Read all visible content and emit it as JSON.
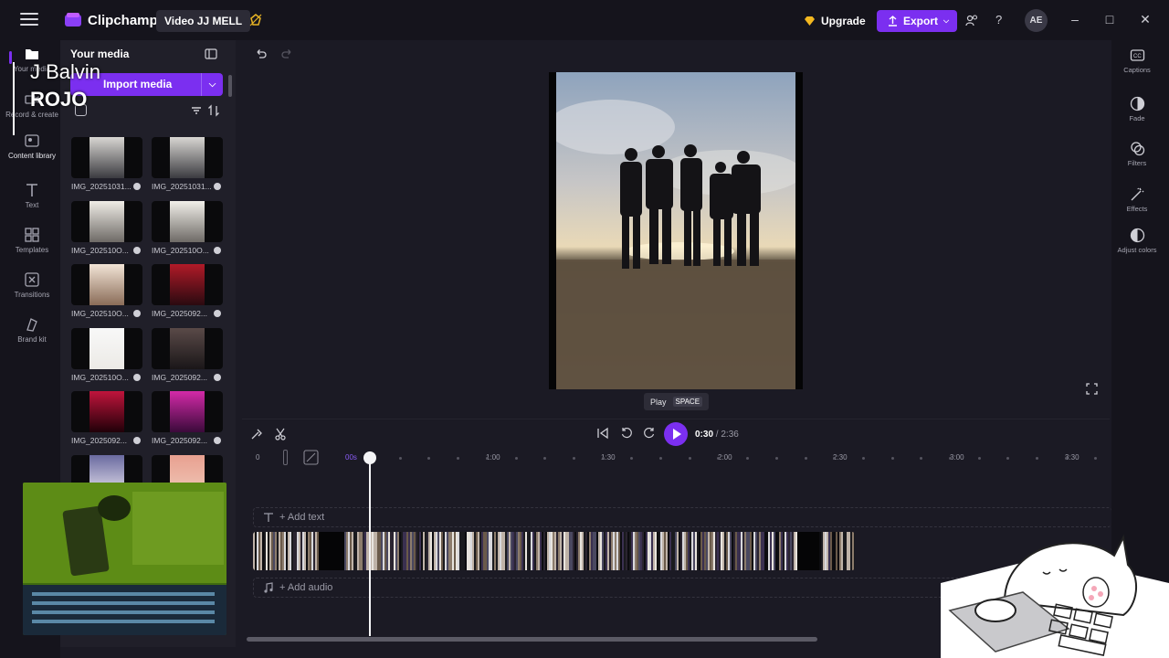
{
  "header": {
    "app_name": "Clipchamp",
    "project_name": "Video JJ MELL",
    "upgrade_label": "Upgrade",
    "export_label": "Export",
    "avatar_initials": "AE",
    "accent_color": "#7b2ff0"
  },
  "left_nav": {
    "items": [
      {
        "label": "Your media",
        "icon": "folder-icon"
      },
      {
        "label": "Record & create",
        "icon": "record-icon"
      },
      {
        "label": "Content library",
        "icon": "library-icon"
      },
      {
        "label": "Text",
        "icon": "text-icon"
      },
      {
        "label": "Templates",
        "icon": "templates-icon"
      },
      {
        "label": "Transitions",
        "icon": "transitions-icon"
      },
      {
        "label": "Brand kit",
        "icon": "brand-kit-icon"
      }
    ]
  },
  "media_panel": {
    "title": "Your media",
    "import_label": "Import media",
    "items": [
      {
        "name": "IMG_20251031..."
      },
      {
        "name": "IMG_20251031..."
      },
      {
        "name": "IMG_202510O..."
      },
      {
        "name": "IMG_202510O..."
      },
      {
        "name": "IMG_202510O..."
      },
      {
        "name": "IMG_2025092..."
      },
      {
        "name": "IMG_202510O..."
      },
      {
        "name": "IMG_2025092..."
      },
      {
        "name": "IMG_2025092..."
      },
      {
        "name": "IMG_2025092..."
      },
      {
        "name": ""
      },
      {
        "name": ""
      }
    ]
  },
  "player": {
    "tooltip_label": "Play",
    "tooltip_key": "SPACE",
    "current_time": "0:30",
    "total_time": "/ 2:36"
  },
  "right_panel": {
    "items": [
      {
        "label": "Captions",
        "icon": "captions-icon"
      },
      {
        "label": "Fade",
        "icon": "fade-icon"
      },
      {
        "label": "Filters",
        "icon": "filters-icon"
      },
      {
        "label": "Effects",
        "icon": "effects-icon"
      },
      {
        "label": "Adjust colors",
        "icon": "adjust-colors-icon"
      }
    ]
  },
  "timeline": {
    "ruler": [
      "0",
      "00s",
      "1:00",
      "1:30",
      "2:00",
      "2:30",
      "3:00",
      "3:30"
    ],
    "add_text_label": "+ Add text",
    "add_audio_label": "+ Add audio"
  },
  "overlay": {
    "artist": "J Balvin",
    "song": "ROJO"
  }
}
